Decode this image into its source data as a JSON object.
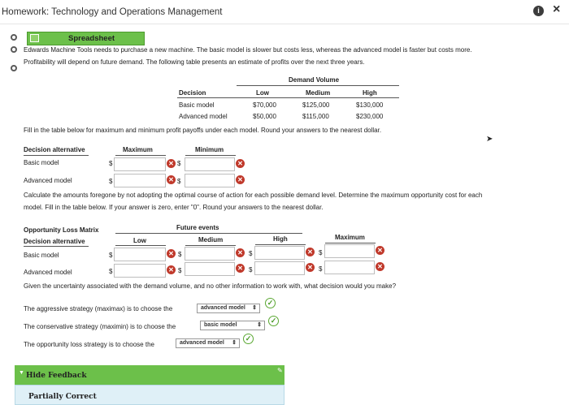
{
  "window": {
    "title": "Homework: Technology and Operations Management"
  },
  "tab": {
    "label": "Spreadsheet"
  },
  "intro": {
    "line1": "Edwards Machine Tools needs to purchase a new machine. The basic model is slower but costs less, whereas the advanced model is faster but costs more.",
    "line2": "Profitability will depend on future demand. The following table presents an estimate of profits over the next three years."
  },
  "profit_table": {
    "group_header": "Demand Volume",
    "headers": [
      "Decision",
      "Low",
      "Medium",
      "High"
    ],
    "rows": [
      [
        "Basic model",
        "$70,000",
        "$125,000",
        "$130,000"
      ],
      [
        "Advanced model",
        "$50,000",
        "$115,000",
        "$230,000"
      ]
    ]
  },
  "q1": {
    "instruction": "Fill in the table below for maximum and minimum profit payoffs under each model. Round your answers to the nearest dollar.",
    "headers": [
      "Decision alternative",
      "Maximum",
      "Minimum"
    ],
    "rows": [
      "Basic model",
      "Advanced model"
    ],
    "currency": "$"
  },
  "q2": {
    "instruction1": "Calculate the amounts foregone by not adopting the optimal course of action for each possible demand level. Determine the maximum opportunity cost for each",
    "instruction2": "model. Fill in the table below. If your answer is zero, enter \"0\". Round your answers to the nearest dollar.",
    "matrix_title": "Opportunity Loss Matrix",
    "future_events": "Future events",
    "headers": [
      "Decision alternative",
      "Low",
      "Medium",
      "High",
      "Maximum"
    ],
    "rows": [
      "Basic model",
      "Advanced model"
    ]
  },
  "q3": {
    "question": "Given the uncertainty associated with the demand volume, and no other information to work with, what decision would you make?",
    "aggressive_label": "The aggressive strategy (maximax) is to choose the",
    "aggressive_value": "advanced model",
    "conservative_label": "The conservative strategy (maximin) is to choose the",
    "conservative_value": "basic model",
    "opportunity_label": "The opportunity loss strategy is to choose the",
    "opportunity_value": "advanced model"
  },
  "feedback": {
    "toggle_label": "Hide Feedback",
    "status": "Partially Correct"
  },
  "icons": {
    "x_mark": "✕",
    "check": "✓",
    "select_arrow": "⇕"
  },
  "colors": {
    "accent_green": "#6cc04a",
    "error_red": "#c0392b",
    "feedback_bg": "#dff0f7"
  }
}
